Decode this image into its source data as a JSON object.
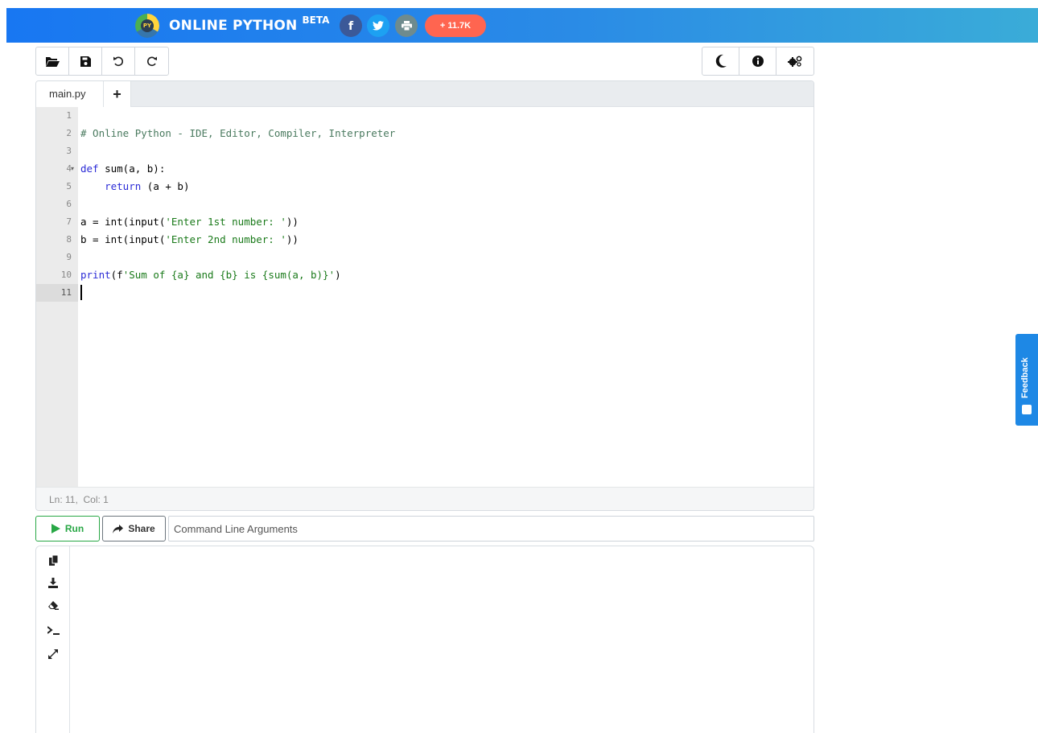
{
  "header": {
    "title": "ONLINE PYTHON",
    "beta": "BETA",
    "logo_text": "PY",
    "social": [
      {
        "name": "facebook",
        "glyph": "f"
      },
      {
        "name": "twitter",
        "glyph": "t"
      },
      {
        "name": "print",
        "glyph": "p"
      }
    ],
    "share_count": "+ 11.7K"
  },
  "toolbar": {
    "left": [
      {
        "name": "open-folder",
        "icon": "folder-open-icon"
      },
      {
        "name": "save",
        "icon": "save-icon"
      },
      {
        "name": "undo",
        "icon": "undo-icon"
      },
      {
        "name": "redo",
        "icon": "redo-icon"
      }
    ],
    "right": [
      {
        "name": "dark-mode",
        "icon": "moon-icon"
      },
      {
        "name": "info",
        "icon": "info-icon"
      },
      {
        "name": "settings",
        "icon": "gears-icon"
      }
    ]
  },
  "editor": {
    "tabs": [
      {
        "label": "main.py"
      }
    ],
    "add_tab_label": "+",
    "line_numbers": [
      "1",
      "2",
      "3",
      "4",
      "5",
      "6",
      "7",
      "8",
      "9",
      "10",
      "11"
    ],
    "lines": {
      "l2_comment": "# Online Python - IDE, Editor, Compiler, Interpreter",
      "l4_kw": "def",
      "l4_rest": " sum(a, b):",
      "l5_indent": "    ",
      "l5_kw": "return",
      "l5_rest": " (a + b)",
      "l7_pre": "a = int(input(",
      "l7_str": "'Enter 1st number: '",
      "l7_post": "))",
      "l8_pre": "b = int(input(",
      "l8_str": "'Enter 2nd number: '",
      "l8_post": "))",
      "l10_kw": "print",
      "l10_paren": "(f",
      "l10_str": "'Sum of {a} and {b} is {sum(a, b)}'",
      "l10_post": ")"
    },
    "status": "Ln: 11,  Col: 1"
  },
  "run": {
    "run_label": "Run",
    "share_label": "Share",
    "args_placeholder": "Command Line Arguments"
  },
  "output": {
    "tools": [
      {
        "name": "copy",
        "icon": "copy-icon"
      },
      {
        "name": "download",
        "icon": "download-icon"
      },
      {
        "name": "clear",
        "icon": "eraser-icon"
      },
      {
        "name": "terminal",
        "icon": "terminal-icon"
      },
      {
        "name": "expand",
        "icon": "expand-icon"
      }
    ]
  },
  "feedback": {
    "label": "Feedback"
  },
  "colors": {
    "header_start": "#1877f2",
    "header_end": "#3aacd8",
    "run_green": "#28a745",
    "share_pill": "#ff6550",
    "feedback_blue": "#1e88e5"
  }
}
